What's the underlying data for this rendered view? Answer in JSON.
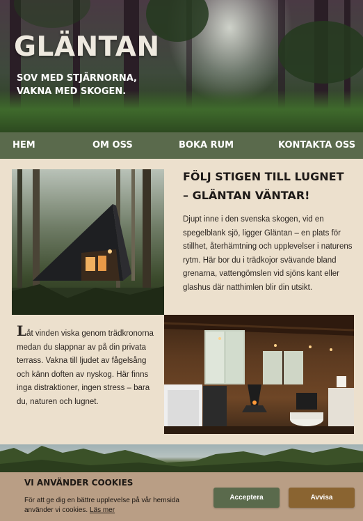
{
  "hero": {
    "title": "GLÄNTAN",
    "subtitle_line1": "SOV MED STJÄRNORNA,",
    "subtitle_line2": "VAKNA MED SKOGEN."
  },
  "nav": {
    "items": [
      {
        "label": "HEM"
      },
      {
        "label": "OM OSS"
      },
      {
        "label": "BOKA RUM"
      },
      {
        "label": "KONTAKTA OSS"
      }
    ]
  },
  "section1": {
    "heading": "FÖLJ STIGEN TILL LUGNET – GLÄNTAN VÄNTAR!",
    "text": "Djupt inne i den svenska skogen, vid en spegelblank sjö, ligger Gläntan – en plats för stillhet, återhämtning och upplevelser i naturens rytm. Här bor du i trädkojor svävande bland grenarna, vattengömslen vid sjöns kant eller glashus där natthimlen blir din utsikt."
  },
  "section2": {
    "drop_letter": "L",
    "text": "åt vinden viska genom trädkronorna medan du slappnar av på din privata terrass. Vakna till ljudet av fågelsång och känn doften av nyskog. Här finns inga distraktioner, ingen stress – bara du, naturen och lugnet."
  },
  "cookie": {
    "title": "VI ANVÄNDER COOKIES",
    "text": "För att ge dig en bättre upplevelse på vår hemsida använder vi cookies.",
    "link": "Läs mer",
    "accept": "Acceptera",
    "reject": "Avvisa"
  },
  "colors": {
    "nav_bg": "#5a6a4c",
    "page_bg": "#ece0cd",
    "cookie_bg": "#b99e85",
    "accept_bg": "#5a6a4c",
    "reject_bg": "#8a6431"
  }
}
